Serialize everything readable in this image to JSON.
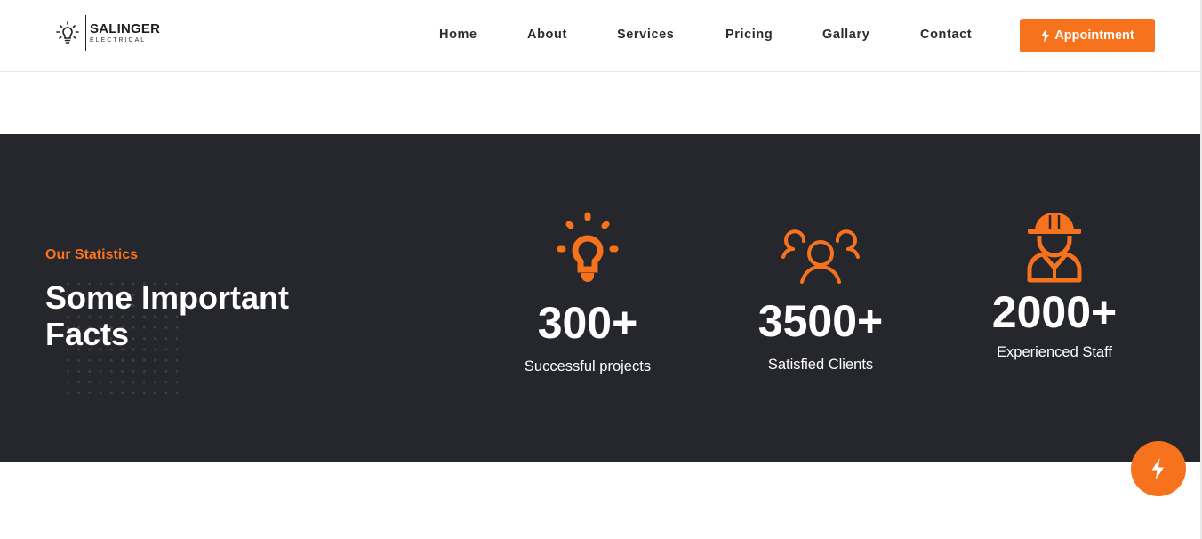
{
  "brand": {
    "name": "SALINGER",
    "sub": "ELECTRICAL",
    "icon": "lightbulb-icon"
  },
  "nav": {
    "items": [
      {
        "label": "Home"
      },
      {
        "label": "About"
      },
      {
        "label": "Services"
      },
      {
        "label": "Pricing"
      },
      {
        "label": "Gallary"
      },
      {
        "label": "Contact"
      }
    ],
    "cta": {
      "label": "Appointment",
      "icon": "bolt-icon"
    }
  },
  "stats": {
    "eyebrow": "Our Statistics",
    "title": "Some Important Facts",
    "items": [
      {
        "number": "300+",
        "label": "Successful projects",
        "icon": "lightbulb-icon"
      },
      {
        "number": "3500+",
        "label": "Satisfied Clients",
        "icon": "users-icon"
      },
      {
        "number": "2000+",
        "label": "Experienced Staff",
        "icon": "worker-icon"
      }
    ]
  },
  "fab": {
    "icon": "bolt-icon"
  },
  "colors": {
    "accent": "#f7721c",
    "dark_bg": "#26272c",
    "nav_text": "#2b2b30",
    "white": "#ffffff"
  }
}
